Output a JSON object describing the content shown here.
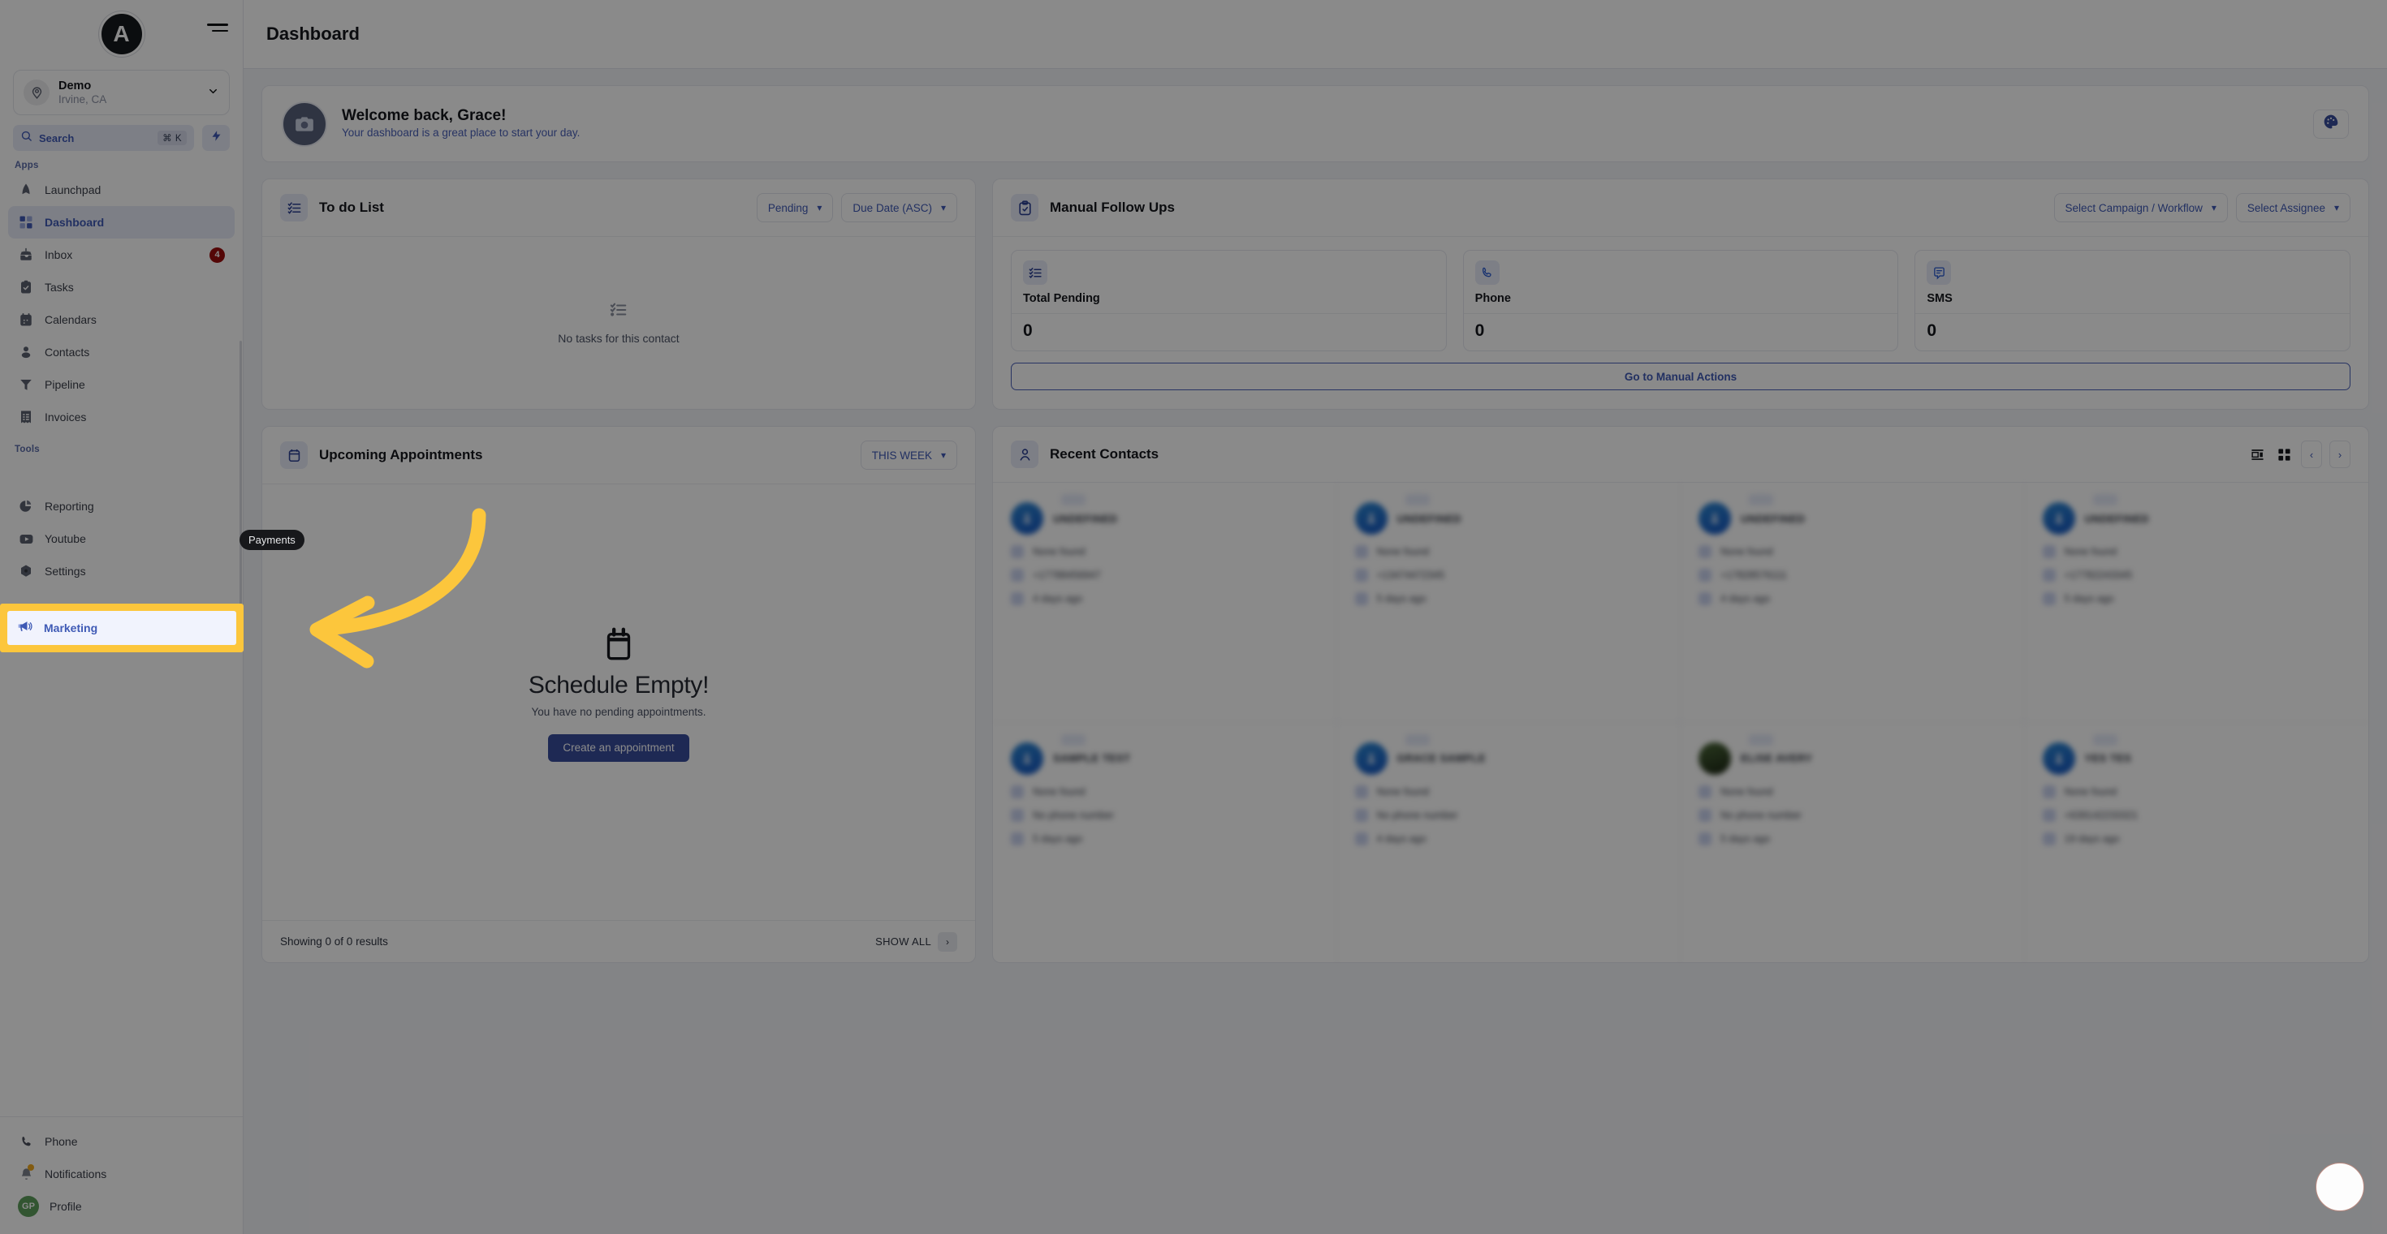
{
  "sidebar": {
    "logo_text": "A",
    "location": {
      "name": "Demo",
      "sub": "Irvine, CA"
    },
    "search": {
      "label": "Search",
      "shortcut": "⌘ K"
    },
    "groups": [
      {
        "label": "Apps",
        "items": [
          {
            "label": "Launchpad",
            "icon": "launchpad-icon"
          },
          {
            "label": "Dashboard",
            "icon": "dashboard-icon",
            "active": true
          },
          {
            "label": "Inbox",
            "icon": "inbox-icon",
            "badge": "4"
          },
          {
            "label": "Tasks",
            "icon": "tasks-icon"
          },
          {
            "label": "Calendars",
            "icon": "calendar-icon"
          },
          {
            "label": "Contacts",
            "icon": "contacts-icon"
          },
          {
            "label": "Pipeline",
            "icon": "pipeline-icon"
          },
          {
            "label": "Invoices",
            "icon": "invoices-icon"
          }
        ]
      },
      {
        "label": "Tools",
        "items": [
          {
            "label": "Marketing",
            "icon": "megaphone-icon",
            "highlighted": true
          },
          {
            "label": "Reporting",
            "icon": "reporting-icon"
          },
          {
            "label": "Youtube",
            "icon": "youtube-icon"
          },
          {
            "label": "Settings",
            "icon": "settings-icon"
          }
        ]
      }
    ],
    "footer": [
      {
        "label": "Phone",
        "icon": "phone-icon"
      },
      {
        "label": "Notifications",
        "icon": "bell-icon"
      },
      {
        "label": "Profile",
        "icon": "avatar-icon",
        "initials": "GP"
      }
    ]
  },
  "topbar": {
    "title": "Dashboard"
  },
  "welcome": {
    "title": "Welcome back, Grace!",
    "subtitle": "Your dashboard is a great place to start your day."
  },
  "todo": {
    "title": "To do List",
    "filter_status": "Pending",
    "filter_sort": "Due Date (ASC)",
    "empty_text": "No tasks for this contact"
  },
  "follow_ups": {
    "title": "Manual Follow Ups",
    "filter_campaign": "Select Campaign / Workflow",
    "filter_assignee": "Select Assignee",
    "stats": [
      {
        "label": "Total Pending",
        "value": "0",
        "icon": "checklist-icon"
      },
      {
        "label": "Phone",
        "value": "0",
        "icon": "phone-icon"
      },
      {
        "label": "SMS",
        "value": "0",
        "icon": "sms-icon"
      }
    ],
    "action_label": "Go to Manual Actions"
  },
  "appointments": {
    "title": "Upcoming Appointments",
    "range": "THIS WEEK",
    "empty_title": "Schedule Empty!",
    "empty_sub": "You have no pending appointments.",
    "cta": "Create an appointment",
    "footer_results": "Showing 0 of 0 results",
    "show_all": "SHOW ALL"
  },
  "contacts": {
    "title": "Recent Contacts",
    "items": [
      {
        "name": "UNDEFINED",
        "email": "None found",
        "phone": "+17788456947",
        "ago": "4 days ago",
        "avatar": "person"
      },
      {
        "name": "UNDEFINED",
        "email": "None found",
        "phone": "+13474472345",
        "ago": "5 days ago",
        "avatar": "person"
      },
      {
        "name": "UNDEFINED",
        "email": "None found",
        "phone": "+17828576111",
        "ago": "4 days ago",
        "avatar": "person"
      },
      {
        "name": "UNDEFINED",
        "email": "None found",
        "phone": "+17782243345",
        "ago": "5 days ago",
        "avatar": "person"
      },
      {
        "name": "SAMPLE TEST",
        "email": "None found",
        "phone": "No phone number",
        "ago": "5 days ago",
        "avatar": "person"
      },
      {
        "name": "GRACE SAMPLE",
        "email": "None found",
        "phone": "No phone number",
        "ago": "4 days ago",
        "avatar": "person"
      },
      {
        "name": "ELISE AVERY",
        "email": "None found",
        "phone": "No phone number",
        "ago": "5 days ago",
        "avatar": "photo"
      },
      {
        "name": "YES TES",
        "email": "None found",
        "phone": "+639142233321",
        "ago": "19 days ago",
        "avatar": "person"
      }
    ]
  },
  "overlay": {
    "tooltip_label": "Payments",
    "highlight_color": "#fcc63c"
  }
}
